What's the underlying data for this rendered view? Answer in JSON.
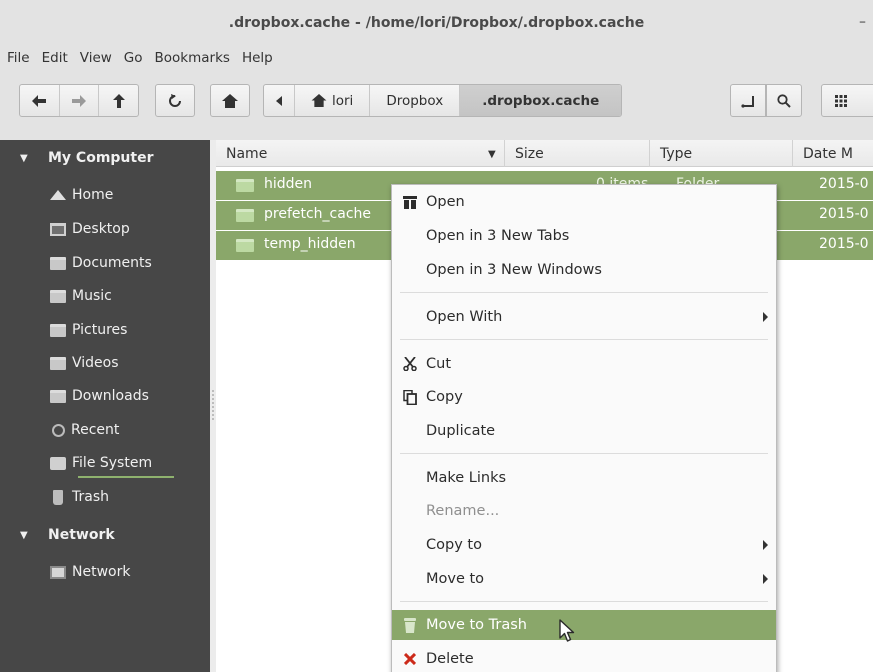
{
  "window": {
    "title": ".dropbox.cache - /home/lori/Dropbox/.dropbox.cache",
    "minimize_glyph": "–"
  },
  "menubar": [
    "File",
    "Edit",
    "View",
    "Go",
    "Bookmarks",
    "Help"
  ],
  "toolbar": {
    "crumbs": [
      "lori",
      "Dropbox",
      ".dropbox.cache"
    ]
  },
  "sidebar": {
    "sections": [
      {
        "title": "My Computer",
        "items": [
          {
            "label": "Home",
            "icon": "home-icon"
          },
          {
            "label": "Desktop",
            "icon": "desktop-icon"
          },
          {
            "label": "Documents",
            "icon": "documents-folder-icon"
          },
          {
            "label": "Music",
            "icon": "music-folder-icon"
          },
          {
            "label": "Pictures",
            "icon": "pictures-folder-icon"
          },
          {
            "label": "Videos",
            "icon": "videos-folder-icon"
          },
          {
            "label": "Downloads",
            "icon": "downloads-folder-icon"
          },
          {
            "label": "Recent",
            "icon": "recent-icon"
          },
          {
            "label": "File System",
            "icon": "disk-icon"
          },
          {
            "label": "Trash",
            "icon": "trash-icon"
          }
        ]
      },
      {
        "title": "Network",
        "items": [
          {
            "label": "Network",
            "icon": "network-icon"
          }
        ]
      }
    ]
  },
  "columns": [
    "Name",
    "Size",
    "Type",
    "Date M"
  ],
  "files": [
    {
      "name": "hidden",
      "size": "0 items",
      "type": "Folder",
      "date": "2015-0"
    },
    {
      "name": "prefetch_cache",
      "size": "",
      "type": "",
      "date": "2015-0"
    },
    {
      "name": "temp_hidden",
      "size": "",
      "type": "",
      "date": "2015-0"
    }
  ],
  "context_menu": {
    "items": [
      {
        "label": "Open",
        "icon": "open-icon"
      },
      {
        "label": "Open in 3 New Tabs"
      },
      {
        "label": "Open in 3 New Windows"
      },
      {
        "label": "Open With",
        "submenu": true
      },
      {
        "label": "Cut",
        "icon": "cut-icon"
      },
      {
        "label": "Copy",
        "icon": "copy-icon"
      },
      {
        "label": "Duplicate"
      },
      {
        "label": "Make Links"
      },
      {
        "label": "Rename...",
        "disabled": true
      },
      {
        "label": "Copy to",
        "submenu": true
      },
      {
        "label": "Move to",
        "submenu": true
      },
      {
        "label": "Move to Trash",
        "icon": "trash-icon",
        "highlighted": true
      },
      {
        "label": "Delete",
        "icon": "delete-icon"
      }
    ]
  },
  "colors": {
    "selection": "#8aa76a",
    "sidebar_bg": "#474747",
    "delete_red": "#cc2a1a"
  }
}
